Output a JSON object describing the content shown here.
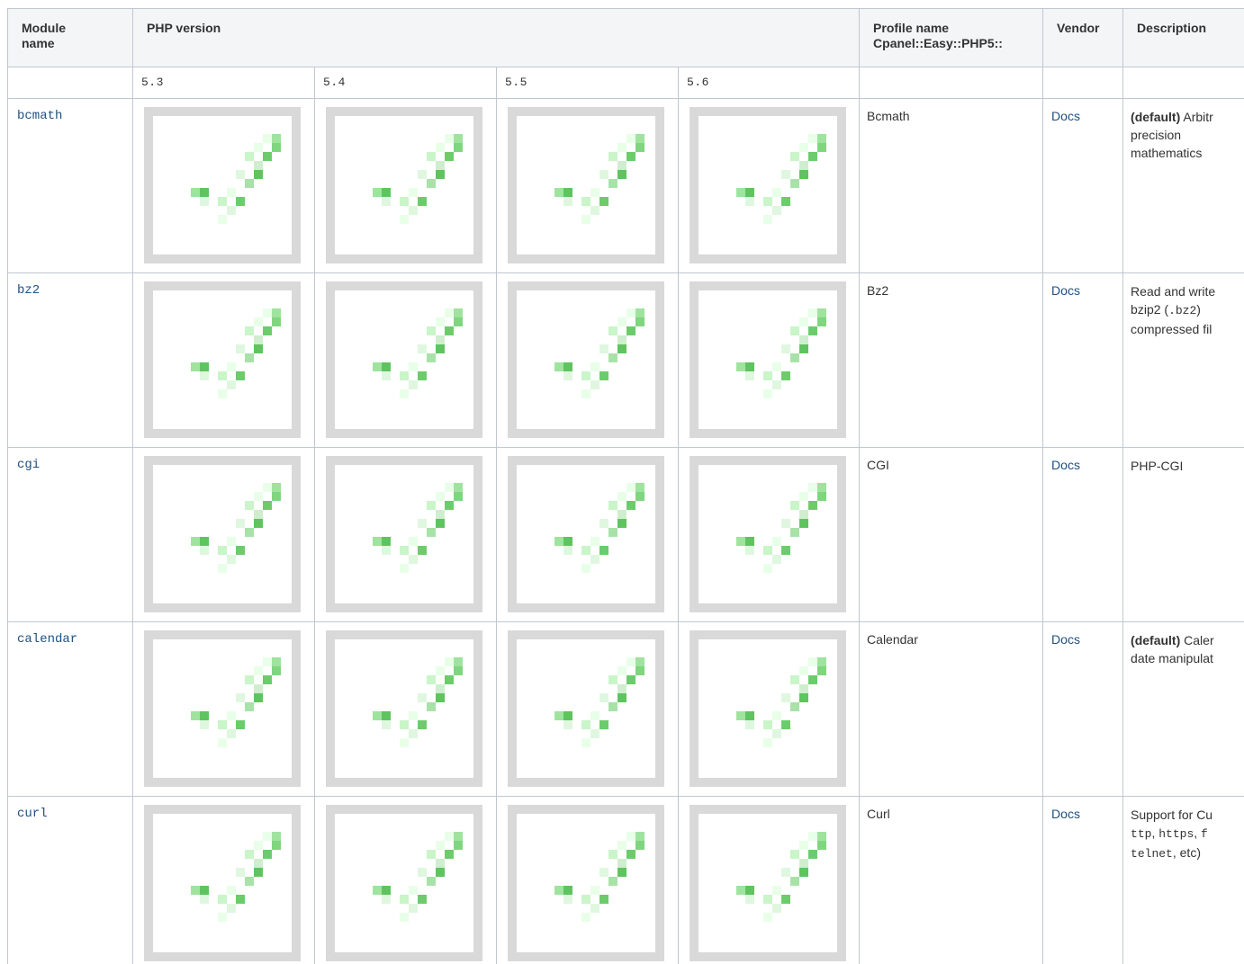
{
  "headers": {
    "module": "Module name",
    "php_version": "PHP version",
    "profile": "Profile name Cpanel::Easy::PHP5::",
    "vendor": "Vendor",
    "description": "Description"
  },
  "versions": [
    "5.3",
    "5.4",
    "5.5",
    "5.6"
  ],
  "rows": [
    {
      "module": "bcmath",
      "supported": [
        true,
        true,
        true,
        true
      ],
      "profile": "Bcmath",
      "vendor": "Docs",
      "desc_line1_bold": "(default)",
      "desc_line1_text": " Arbitr",
      "desc_line2": "precision",
      "desc_line3": "mathematics"
    },
    {
      "module": "bz2",
      "supported": [
        true,
        true,
        true,
        true
      ],
      "profile": "Bz2",
      "vendor": "Docs",
      "desc_line1": "Read and write",
      "desc_line2_pre": "bzip2 (",
      "desc_line2_code": ".bz2",
      "desc_line2_post": ")",
      "desc_line3": "compressed fil"
    },
    {
      "module": "cgi",
      "supported": [
        true,
        true,
        true,
        true
      ],
      "profile": "CGI",
      "vendor": "Docs",
      "desc_line1": "PHP-CGI"
    },
    {
      "module": "calendar",
      "supported": [
        true,
        true,
        true,
        true
      ],
      "profile": "Calendar",
      "vendor": "Docs",
      "desc_line1_bold": "(default)",
      "desc_line1_text": " Caler",
      "desc_line2": "date manipulat"
    },
    {
      "module": "curl",
      "supported": [
        true,
        true,
        true,
        true
      ],
      "profile": "Curl",
      "vendor": "Docs",
      "desc_line1": "Support for Cu",
      "desc_line2_code1": "ttp",
      "desc_line2_sep1": ", ",
      "desc_line2_code2": "https",
      "desc_line2_sep2": ", ",
      "desc_line2_code3": "f",
      "desc_line3_code": "telnet",
      "desc_line3_post": ", etc)"
    }
  ],
  "colors": {
    "check_green": "#0aa10a",
    "check_frame": "#d9d9d9",
    "link": "#205081",
    "border": "#c1c7d0",
    "header_bg": "#f4f5f7"
  },
  "icons": {
    "supported": "checkmark-icon"
  }
}
